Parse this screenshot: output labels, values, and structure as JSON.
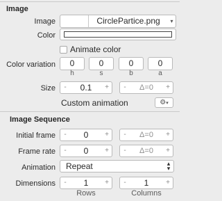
{
  "image_section": {
    "title": "Image",
    "image_label": "Image",
    "image_value": "CirclePartice.png",
    "color_label": "Color",
    "animate_color_label": "Animate color",
    "color_variation_label": "Color variation",
    "color_variation": [
      {
        "value": "0",
        "channel": "h"
      },
      {
        "value": "0",
        "channel": "s"
      },
      {
        "value": "0",
        "channel": "b"
      },
      {
        "value": "0",
        "channel": "a"
      }
    ],
    "size_label": "Size",
    "size_value": "0.1",
    "size_delta": "Δ=0",
    "custom_animation_label": "Custom animation",
    "minus_glyph": "-",
    "plus_glyph": "+"
  },
  "image_sequence": {
    "title": "Image Sequence",
    "initial_frame_label": "Initial frame",
    "initial_frame_value": "0",
    "initial_frame_delta": "Δ=0",
    "frame_rate_label": "Frame rate",
    "frame_rate_value": "0",
    "frame_rate_delta": "Δ=0",
    "animation_label": "Animation",
    "animation_value": "Repeat",
    "dimensions_label": "Dimensions",
    "rows_value": "1",
    "columns_value": "1",
    "rows_label": "Rows",
    "columns_label": "Columns"
  },
  "icons": {
    "gear": "gear-icon",
    "popup_arrows": "up-down-chevron-icon"
  }
}
